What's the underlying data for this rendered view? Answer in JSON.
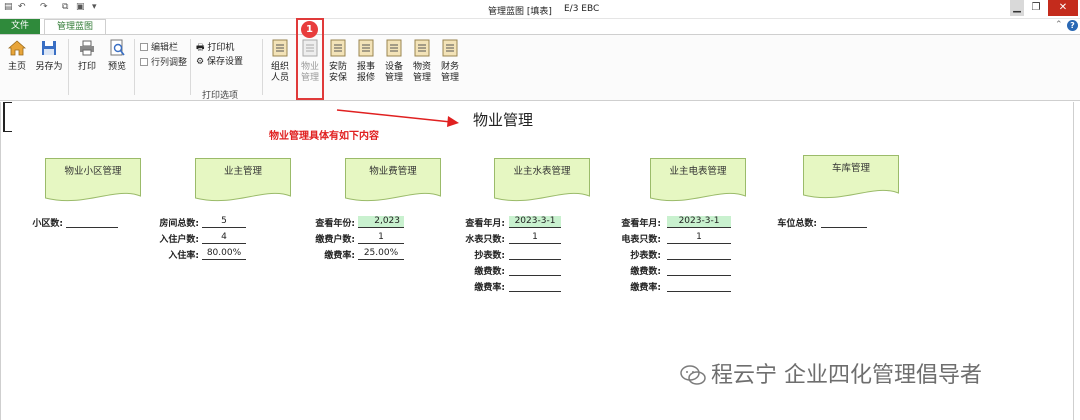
{
  "titlebar": {
    "title": "管理蓝图 [填表]",
    "app": "E/3 EBC",
    "quick_access": [
      "↶",
      "↷",
      "▾"
    ]
  },
  "tabs": {
    "file": "文件",
    "active": "管理蓝图"
  },
  "ribbon": {
    "home": "主页",
    "save_as": "另存为",
    "print": "打印",
    "preview": "预览",
    "edit_bar": "编辑栏",
    "row_col_adjust": "行列调整",
    "printer": "打印机",
    "save_settings": "保存设置",
    "print_options_group": "打印选项",
    "modules": [
      {
        "line1": "组织",
        "line2": "人员",
        "disabled": false
      },
      {
        "line1": "物业",
        "line2": "管理",
        "disabled": true
      },
      {
        "line1": "安防",
        "line2": "安保",
        "disabled": false
      },
      {
        "line1": "报事",
        "line2": "报修",
        "disabled": false
      },
      {
        "line1": "设备",
        "line2": "管理",
        "disabled": false
      },
      {
        "line1": "物资",
        "line2": "管理",
        "disabled": false
      },
      {
        "line1": "财务",
        "line2": "管理",
        "disabled": false
      }
    ],
    "badge": "1"
  },
  "page": {
    "title": "物业管理",
    "annotation": "物业管理具体有如下内容"
  },
  "cards": {
    "community": "物业小区管理",
    "owner": "业主管理",
    "fee": "物业费管理",
    "water": "业主水表管理",
    "electric": "业主电表管理",
    "garage": "车库管理"
  },
  "fields": {
    "community": {
      "count_label": "小区数:",
      "count_value": ""
    },
    "owner": {
      "rooms_label": "房间总数:",
      "rooms_value": "5",
      "occupied_label": "入住户数:",
      "occupied_value": "4",
      "rate_label": "入住率:",
      "rate_value": "80.00%"
    },
    "fee": {
      "year_label": "查看年份:",
      "year_value": "2,023",
      "payers_label": "缴费户数:",
      "payers_value": "1",
      "rate_label": "缴费率:",
      "rate_value": "25.00%"
    },
    "water": {
      "month_label": "查看年月:",
      "month_value": "2023-3-1",
      "meters_label": "水表只数:",
      "meters_value": "1",
      "reads_label": "抄表数:",
      "reads_value": "",
      "paid_label": "缴费数:",
      "paid_value": "",
      "rate_label": "缴费率:",
      "rate_value": ""
    },
    "electric": {
      "month_label": "查看年月:",
      "month_value": "2023-3-1",
      "meters_label": "电表只数:",
      "meters_value": "1",
      "reads_label": "抄表数:",
      "reads_value": "",
      "paid_label": "缴费数:",
      "paid_value": "",
      "rate_label": "缴费率:",
      "rate_value": ""
    },
    "garage": {
      "spaces_label": "车位总数:",
      "spaces_value": ""
    }
  },
  "watermark": "程云宁 企业四化管理倡导者",
  "colors": {
    "accent_green": "#2f8a3b",
    "card_fill": "#e6f7c2",
    "highlight_red": "#e03a3a",
    "field_green": "#c9f1cf"
  }
}
